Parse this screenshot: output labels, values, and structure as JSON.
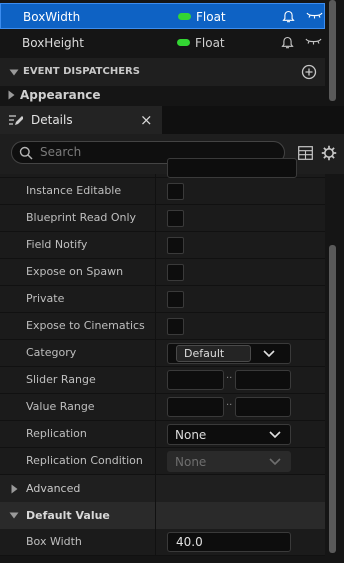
{
  "variables": [
    {
      "name": "BoxWidth",
      "type": "Float",
      "selected": true
    },
    {
      "name": "BoxHeight",
      "type": "Float",
      "selected": false
    }
  ],
  "event_dispatchers": {
    "label": "EVENT DISPATCHERS"
  },
  "appearance": {
    "label": "Appearance"
  },
  "details_tab": {
    "label": "Details",
    "close": "×"
  },
  "search": {
    "placeholder": "Search"
  },
  "properties": {
    "instance_editable": "Instance Editable",
    "blueprint_read_only": "Blueprint Read Only",
    "field_notify": "Field Notify",
    "expose_on_spawn": "Expose on Spawn",
    "private": "Private",
    "expose_to_cinematics": "Expose to Cinematics",
    "category": {
      "label": "Category",
      "value": "Default"
    },
    "slider_range": {
      "label": "Slider Range",
      "separator": ".."
    },
    "value_range": {
      "label": "Value Range",
      "separator": ".."
    },
    "replication": {
      "label": "Replication",
      "value": "None"
    },
    "replication_condition": {
      "label": "Replication Condition",
      "value": "None"
    }
  },
  "advanced": {
    "label": "Advanced"
  },
  "default_value": {
    "label": "Default Value",
    "box_width_label": "Box Width",
    "box_width_value": "40.0"
  },
  "colors": {
    "selection": "#0e62c4",
    "float_pin": "#33d633"
  },
  "icons": [
    "bell-icon",
    "eye-icon",
    "add-icon",
    "details-icon",
    "close-icon",
    "search-icon",
    "grid-icon",
    "gear-icon",
    "chevron-down-icon",
    "chevron-right-icon"
  ]
}
